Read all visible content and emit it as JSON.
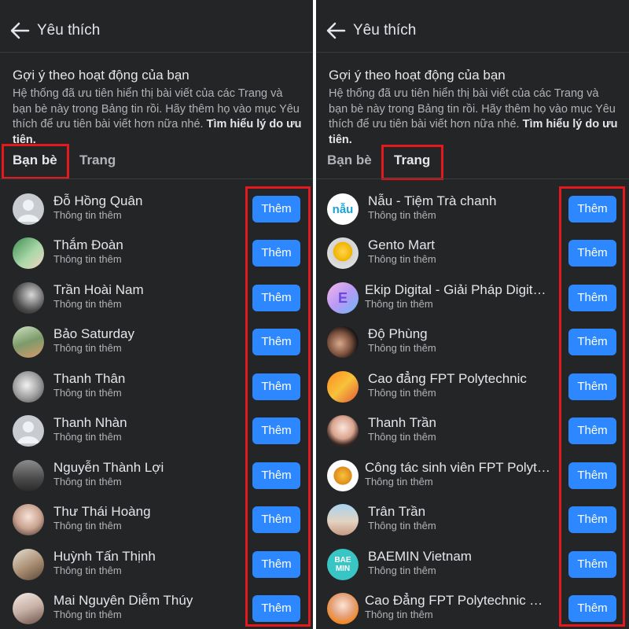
{
  "left": {
    "header_title": "Yêu thích",
    "section_title": "Gợi ý theo hoạt động của bạn",
    "desc_text": "Hệ thống đã ưu tiên hiển thị bài viết của các Trang và bạn bè này trong Bảng tin rồi. Hãy thêm họ vào mục Yêu thích để ưu tiên bài viết hơn nữa nhé.",
    "desc_link": "Tìm hiểu lý do ưu tiên.",
    "tabs": [
      {
        "label": "Bạn bè",
        "active": true
      },
      {
        "label": "Trang",
        "active": false
      }
    ],
    "items": [
      {
        "name": "Đỗ Hồng Quân",
        "sub": "Thông tin thêm",
        "button": "Thêm",
        "avatar": "default-avatar"
      },
      {
        "name": "Thắm Đoàn",
        "sub": "Thông tin thêm",
        "button": "Thêm",
        "avatar": "photo-avatar"
      },
      {
        "name": "Trần Hoài Nam",
        "sub": "Thông tin thêm",
        "button": "Thêm",
        "avatar": "photo-avatar"
      },
      {
        "name": "Bảo Saturday",
        "sub": "Thông tin thêm",
        "button": "Thêm",
        "avatar": "photo-avatar"
      },
      {
        "name": "Thanh Thân",
        "sub": "Thông tin thêm",
        "button": "Thêm",
        "avatar": "photo-avatar"
      },
      {
        "name": "Thanh Nhàn",
        "sub": "Thông tin thêm",
        "button": "Thêm",
        "avatar": "default-avatar"
      },
      {
        "name": "Nguyễn Thành Lợi",
        "sub": "Thông tin thêm",
        "button": "Thêm",
        "avatar": "photo-avatar"
      },
      {
        "name": "Thư Thái Hoàng",
        "sub": "Thông tin thêm",
        "button": "Thêm",
        "avatar": "photo-avatar"
      },
      {
        "name": "Huỳnh Tấn Thịnh",
        "sub": "Thông tin thêm",
        "button": "Thêm",
        "avatar": "photo-avatar"
      },
      {
        "name": "Mai Nguyên Diễm Thúy",
        "sub": "Thông tin thêm",
        "button": "Thêm",
        "avatar": "photo-avatar"
      }
    ]
  },
  "right": {
    "header_title": "Yêu thích",
    "section_title": "Gợi ý theo hoạt động của bạn",
    "desc_text": "Hệ thống đã ưu tiên hiển thị bài viết của các Trang và bạn bè này trong Bảng tin rồi. Hãy thêm họ vào mục Yêu thích để ưu tiên bài viết hơn nữa nhé.",
    "desc_link": "Tìm hiểu lý do ưu tiên.",
    "tabs": [
      {
        "label": "Bạn bè",
        "active": false
      },
      {
        "label": "Trang",
        "active": true
      }
    ],
    "items": [
      {
        "name": "Nẫu - Tiệm Trà chanh",
        "sub": "Thông tin thêm",
        "button": "Thêm",
        "avatar": "logo-avatar",
        "logo_text": "nẫu"
      },
      {
        "name": "Gento Mart",
        "sub": "Thông tin thêm",
        "button": "Thêm",
        "avatar": "photo-avatar"
      },
      {
        "name": "Ekip Digital - Giải Pháp Digital...",
        "sub": "Thông tin thêm",
        "button": "Thêm",
        "avatar": "logo-avatar",
        "logo_text": "E"
      },
      {
        "name": "Độ Phùng",
        "sub": "Thông tin thêm",
        "button": "Thêm",
        "avatar": "photo-avatar"
      },
      {
        "name": "Cao đẳng FPT Polytechnic",
        "sub": "Thông tin thêm",
        "button": "Thêm",
        "avatar": "photo-avatar"
      },
      {
        "name": "Thanh Trần",
        "sub": "Thông tin thêm",
        "button": "Thêm",
        "avatar": "photo-avatar"
      },
      {
        "name": "Công tác sinh viên FPT Polyte...",
        "sub": "Thông tin thêm",
        "button": "Thêm",
        "avatar": "photo-avatar"
      },
      {
        "name": "Trân Trần",
        "sub": "Thông tin thêm",
        "button": "Thêm",
        "avatar": "photo-avatar"
      },
      {
        "name": "BAEMIN Vietnam",
        "sub": "Thông tin thêm",
        "button": "Thêm",
        "avatar": "logo-avatar",
        "logo_text": "BAE MIN"
      },
      {
        "name": "Cao Đẳng FPT Polytechnic TP...",
        "sub": "Thông tin thêm",
        "button": "Thêm",
        "avatar": "photo-avatar"
      }
    ]
  },
  "colors": {
    "background": "#242526",
    "primary_button": "#2d88ff",
    "highlight_box": "#e5181e",
    "text_primary": "#e4e6eb",
    "text_secondary": "#b0b3b8"
  }
}
